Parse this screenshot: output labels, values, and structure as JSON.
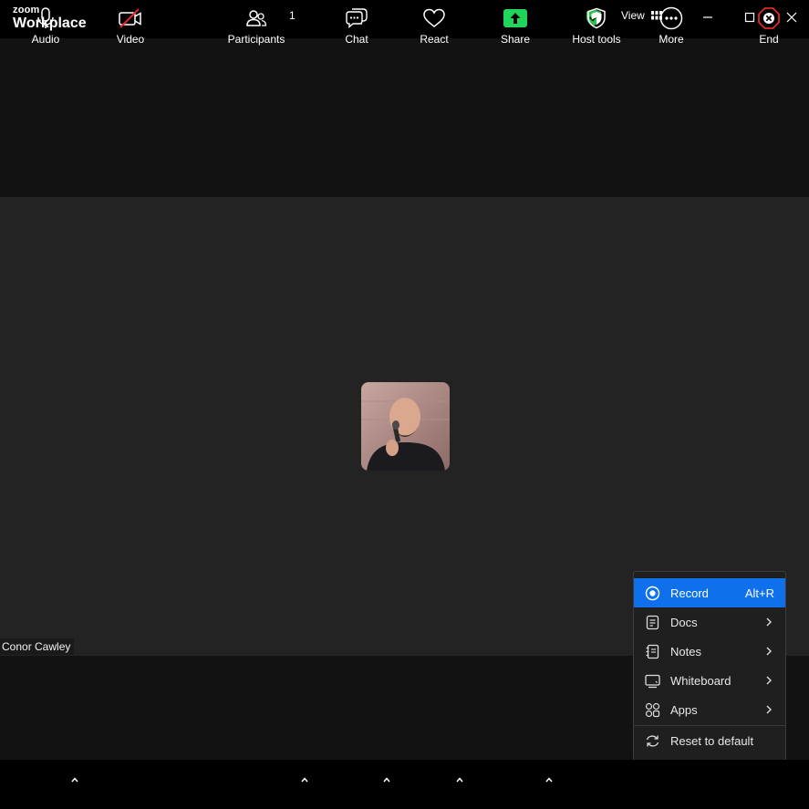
{
  "titlebar": {
    "brand_top": "zoom",
    "brand_bottom": "Workplace",
    "view_label": "View",
    "shield_color": "#2dbe4e"
  },
  "participant": {
    "name": "Conor Cawley"
  },
  "toolbar": {
    "audio": "Audio",
    "video": "Video",
    "participants": "Participants",
    "participants_count": "1",
    "chat": "Chat",
    "react": "React",
    "share": "Share",
    "host_tools": "Host tools",
    "more": "More",
    "end": "End",
    "share_color": "#1fd65a",
    "end_color": "#e02828"
  },
  "more_menu": {
    "items": [
      {
        "label": "Record",
        "shortcut": "Alt+R",
        "icon": "record-icon"
      },
      {
        "label": "Docs",
        "icon": "docs-icon"
      },
      {
        "label": "Notes",
        "icon": "notes-icon"
      },
      {
        "label": "Whiteboard",
        "icon": "whiteboard-icon"
      },
      {
        "label": "Apps",
        "icon": "apps-icon"
      },
      {
        "label": "Reset to default",
        "icon": "reset-icon"
      }
    ],
    "highlight_color": "#0e71eb"
  }
}
